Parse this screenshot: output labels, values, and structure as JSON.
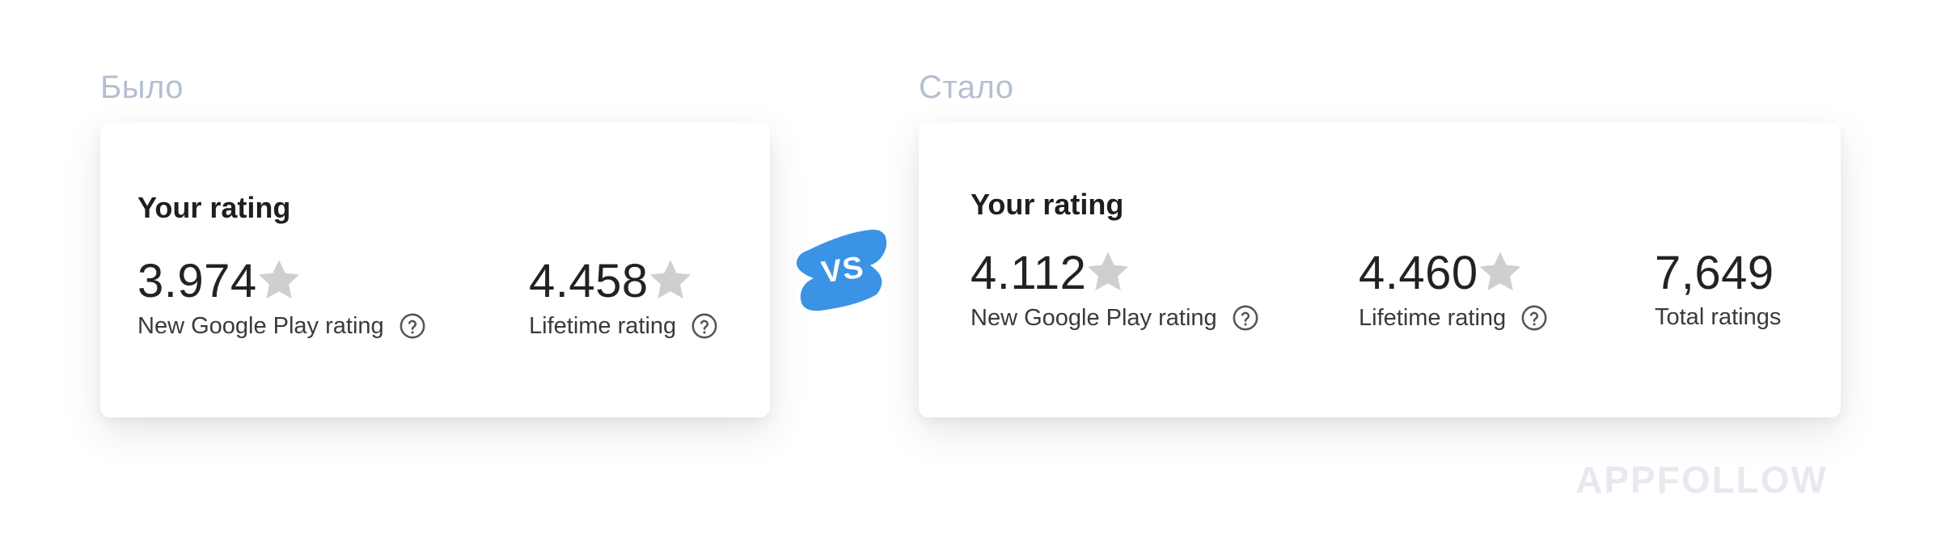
{
  "before": {
    "section_label": "Было",
    "card_title": "Your rating",
    "metrics": [
      {
        "value": "3.974",
        "label": "New Google Play rating",
        "has_star": true,
        "has_help": true
      },
      {
        "value": "4.458",
        "label": "Lifetime rating",
        "has_star": true,
        "has_help": true
      }
    ]
  },
  "vs_badge": {
    "text": "VS",
    "color": "#3b93e6"
  },
  "after": {
    "section_label": "Стало",
    "card_title": "Your rating",
    "metrics": [
      {
        "value": "4.112",
        "label": "New Google Play rating",
        "has_star": true,
        "has_help": true
      },
      {
        "value": "4.460",
        "label": "Lifetime rating",
        "has_star": true,
        "has_help": true
      },
      {
        "value": "7,649",
        "label": "Total ratings",
        "has_star": false,
        "has_help": false
      }
    ]
  },
  "watermark": "APPFOLLOW",
  "colors": {
    "star": "#cfcfcf",
    "section_label": "#b4bfd1",
    "help_icon": "#555555",
    "accent": "#3b93e6"
  }
}
